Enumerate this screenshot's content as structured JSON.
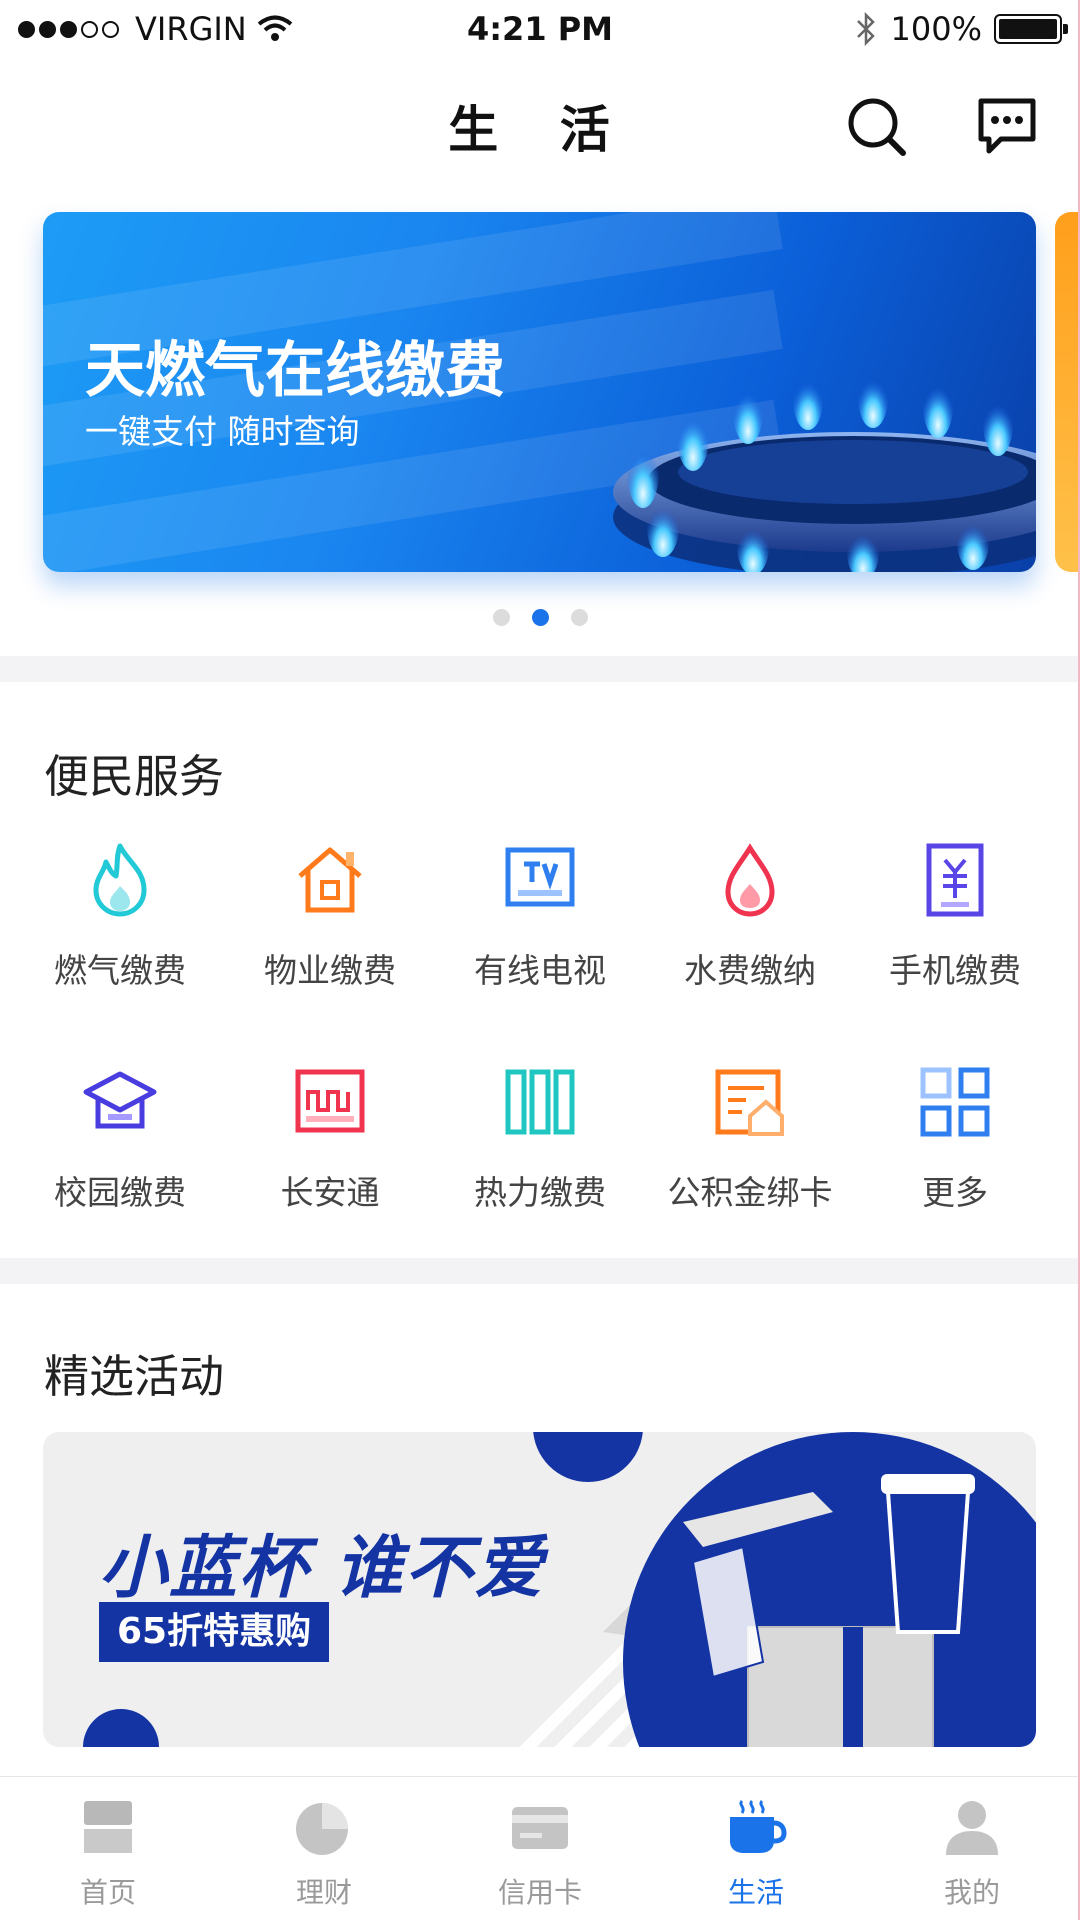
{
  "status_bar": {
    "carrier": "VIRGIN",
    "time": "4:21 PM",
    "battery": "100%",
    "signal_bars_filled": 3,
    "signal_bars_total": 5
  },
  "nav": {
    "title": "生 活",
    "search_icon": "search-icon",
    "message_icon": "message-icon"
  },
  "banner": {
    "title": "天燃气在线缴费",
    "subtitle": "一键支付 随时查询",
    "pager_count": 3,
    "pager_active": 1
  },
  "services": {
    "title": "便民服务",
    "items": [
      {
        "label": "燃气缴费",
        "icon": "flame-icon",
        "color": "#22c9d6"
      },
      {
        "label": "物业缴费",
        "icon": "house-icon",
        "color": "#ff7a1a"
      },
      {
        "label": "有线电视",
        "icon": "tv-icon",
        "color": "#2f7ff0"
      },
      {
        "label": "水费缴纳",
        "icon": "water-drop-icon",
        "color": "#f0334f"
      },
      {
        "label": "手机缴费",
        "icon": "phone-yuan-icon",
        "color": "#5a45e6"
      },
      {
        "label": "校园缴费",
        "icon": "graduation-cap-icon",
        "color": "#4a3de0"
      },
      {
        "label": "长安通",
        "icon": "transit-card-icon",
        "color": "#f0334f"
      },
      {
        "label": "热力缴费",
        "icon": "heat-bars-icon",
        "color": "#1fc7c0"
      },
      {
        "label": "公积金绑卡",
        "icon": "fund-house-icon",
        "color": "#ff7a1a"
      },
      {
        "label": "更多",
        "icon": "more-grid-icon",
        "color": "#2f7ff0"
      }
    ]
  },
  "activities": {
    "title": "精选活动",
    "promo_title": "小蓝杯 谁不爱",
    "promo_badge": "65折特惠购",
    "promo_color": "#1434a4"
  },
  "tabbar": {
    "active_index": 3,
    "active_color": "#1a73e8",
    "items": [
      {
        "label": "首页",
        "icon": "home-icon"
      },
      {
        "label": "理财",
        "icon": "pie-chart-icon"
      },
      {
        "label": "信用卡",
        "icon": "credit-card-icon"
      },
      {
        "label": "生活",
        "icon": "coffee-cup-icon"
      },
      {
        "label": "我的",
        "icon": "user-icon"
      }
    ]
  }
}
